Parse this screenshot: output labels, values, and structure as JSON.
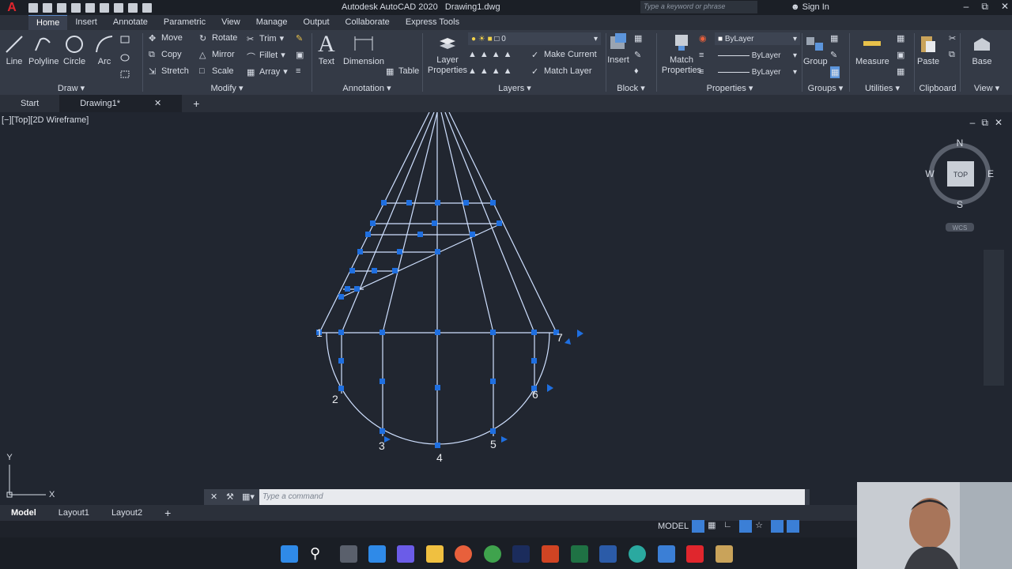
{
  "window": {
    "app_title": "Autodesk AutoCAD 2020",
    "file_title": "Drawing1.dwg",
    "search_placeholder": "Type a keyword or phrase",
    "sign_in": "Sign In"
  },
  "ribbon_tabs": [
    "Home",
    "Insert",
    "Annotate",
    "Parametric",
    "View",
    "Manage",
    "Output",
    "Collaborate",
    "Express Tools"
  ],
  "ribbon": {
    "draw": {
      "title": "Draw",
      "line": "Line",
      "polyline": "Polyline",
      "circle": "Circle",
      "arc": "Arc"
    },
    "modify": {
      "title": "Modify",
      "move": "Move",
      "rotate": "Rotate",
      "trim": "Trim",
      "copy": "Copy",
      "mirror": "Mirror",
      "fillet": "Fillet",
      "stretch": "Stretch",
      "scale": "Scale",
      "array": "Array"
    },
    "annotation": {
      "title": "Annotation",
      "text": "Text",
      "dimension": "Dimension",
      "table": "Table"
    },
    "layers": {
      "title": "Layers",
      "layer_properties": "Layer Properties",
      "current_layer": "0",
      "make_current": "Make Current",
      "match_layer": "Match Layer"
    },
    "block": {
      "title": "Block",
      "insert": "Insert"
    },
    "properties": {
      "title": "Properties",
      "match_properties": "Match Properties",
      "color": "ByLayer",
      "linetype": "ByLayer",
      "lineweight": "ByLayer"
    },
    "groups": {
      "title": "Groups",
      "group": "Group"
    },
    "utilities": {
      "title": "Utilities",
      "measure": "Measure"
    },
    "clipboard": {
      "title": "Clipboard",
      "paste": "Paste"
    },
    "view": {
      "title": "View",
      "base": "Base"
    }
  },
  "file_tabs": [
    "Start",
    "Drawing1*"
  ],
  "viewport": {
    "label": "[−][Top][2D Wireframe]",
    "viewcube": {
      "n": "N",
      "s": "S",
      "e": "E",
      "w": "W",
      "top": "TOP",
      "wcs": "WCS"
    },
    "point_labels": [
      "1",
      "2",
      "3",
      "4",
      "5",
      "6",
      "7"
    ],
    "ucs": {
      "x": "X",
      "y": "Y"
    }
  },
  "command_line": {
    "placeholder": "Type a command"
  },
  "layout_tabs": [
    "Model",
    "Layout1",
    "Layout2"
  ],
  "status": {
    "model": "MODEL"
  },
  "colors": {
    "accent": "#3b7fd6",
    "wire": "#cfe0ff",
    "grip": "#1f6fe0",
    "background": "#212630"
  }
}
